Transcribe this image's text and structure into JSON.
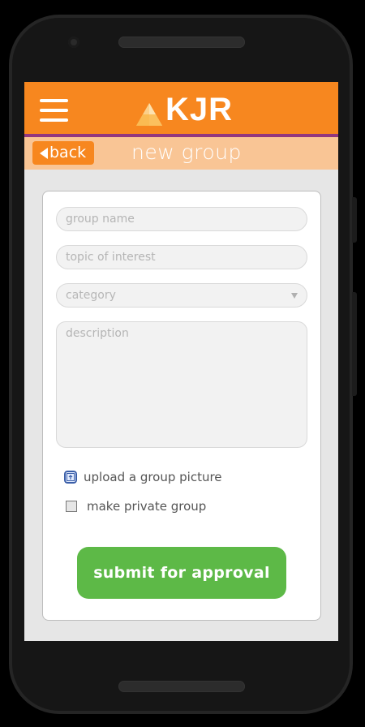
{
  "header": {
    "logo_text": "KJR",
    "brand_color": "#f7871f",
    "accent_line_color": "#92377e"
  },
  "subheader": {
    "back_label": "back",
    "title": "new group"
  },
  "form": {
    "group_name_placeholder": "group name",
    "topic_placeholder": "topic of interest",
    "category_placeholder": "category",
    "description_placeholder": "description",
    "upload_label": "upload a group picture",
    "private_label": "make private group",
    "submit_label": "submit for approval",
    "submit_color": "#5db947"
  },
  "icons": {
    "menu": "hamburger-icon",
    "back": "back-arrow-icon",
    "upload": "upload-icon",
    "dropdown": "chevron-down-icon"
  }
}
